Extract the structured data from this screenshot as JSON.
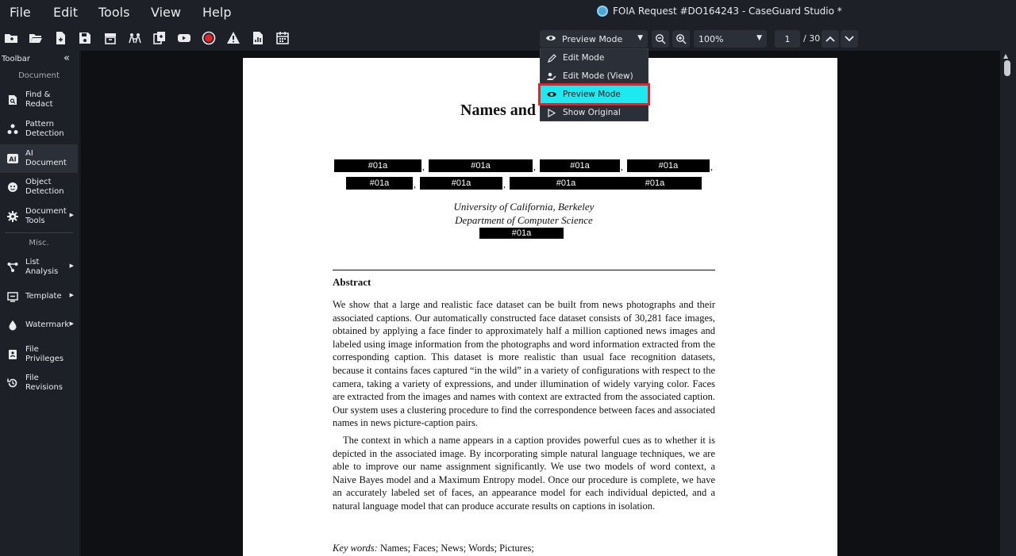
{
  "menu": [
    "File",
    "Edit",
    "Tools",
    "View",
    "Help"
  ],
  "window_title": "FOIA Request #DO164243 - CaseGuard Studio *",
  "toolbar_icons": [
    "new-folder-icon",
    "open-folder-icon",
    "new-file-icon",
    "save-icon",
    "archive-icon",
    "people-icon",
    "copy-icon",
    "video-icon",
    "record-icon",
    "warning-icon",
    "document-chart-icon",
    "calendar-icon"
  ],
  "view_mode": {
    "selected": "Preview Mode"
  },
  "zoom": {
    "value": "100%"
  },
  "pagination": {
    "current": "1",
    "total": "/ 30"
  },
  "dropdown": {
    "items": [
      {
        "label": "Edit Mode",
        "icon": "pencil-icon"
      },
      {
        "label": "Edit Mode (View)",
        "icon": "user-edit-icon"
      },
      {
        "label": "Preview Mode",
        "icon": "eye-icon"
      },
      {
        "label": "Show Original",
        "icon": "play-outline-icon"
      }
    ]
  },
  "sidebar": {
    "header": "Toolbar",
    "collapse": "«",
    "section_document": "Document",
    "section_misc": "Misc.",
    "items": [
      {
        "label": "Find &\nRedact",
        "icon": "find-redact-icon"
      },
      {
        "label": "Pattern\nDetection",
        "icon": "pattern-icon"
      },
      {
        "label": "AI\nDocument",
        "icon": "ai-icon"
      },
      {
        "label": "Object\nDetection",
        "icon": "face-icon"
      },
      {
        "label": "Document\nTools",
        "icon": "gear-icon"
      },
      {
        "label": "List\nAnalysis",
        "icon": "list-analysis-icon"
      },
      {
        "label": "Template",
        "icon": "template-icon"
      },
      {
        "label": "Watermark",
        "icon": "watermark-icon"
      },
      {
        "label": "File\nPrivileges",
        "icon": "privileges-icon"
      },
      {
        "label": "File\nRevisions",
        "icon": "revisions-icon"
      }
    ]
  },
  "document": {
    "title": "Names and",
    "redaction_label": "#01a",
    "affiliation_1": "University of California, Berkeley",
    "affiliation_2": "Department of Computer Science",
    "abstract_heading": "Abstract",
    "paragraph_1": "We show that a large and realistic face dataset can be built from news photographs and their associated captions. Our automatically constructed face dataset consists of 30,281 face images, obtained by applying a face finder to approximately half a million captioned news images and labeled using image information from the photographs and word information extracted from the corresponding caption. This dataset is more realistic than usual face recognition datasets, because it contains faces captured “in the wild” in a variety of configurations with respect to the camera, taking a variety of expressions, and under illumination of widely varying color. Faces are extracted from the images and names with context are extracted from the associated caption. Our system uses a clustering procedure to find the correspondence between faces and associated names in news picture-caption pairs.",
    "paragraph_2": "The context in which a name appears in a caption provides powerful cues as to whether it is depicted in the associated image. By incorporating simple natural language techniques, we are able to improve our name assignment significantly. We use two models of word context, a Naive Bayes model and a Maximum Entropy model. Once our procedure is complete, we have an accurately labeled set of faces, an appearance model for each individual depicted, and a natural language model that can produce accurate results on captions in isolation.",
    "keywords_label": "Key words:",
    "keywords": "Names; Faces; News; Words; Pictures;"
  },
  "colors": {
    "highlight": "#1ee8f0",
    "selection_border": "#e0242b",
    "record": "#e0242b"
  }
}
